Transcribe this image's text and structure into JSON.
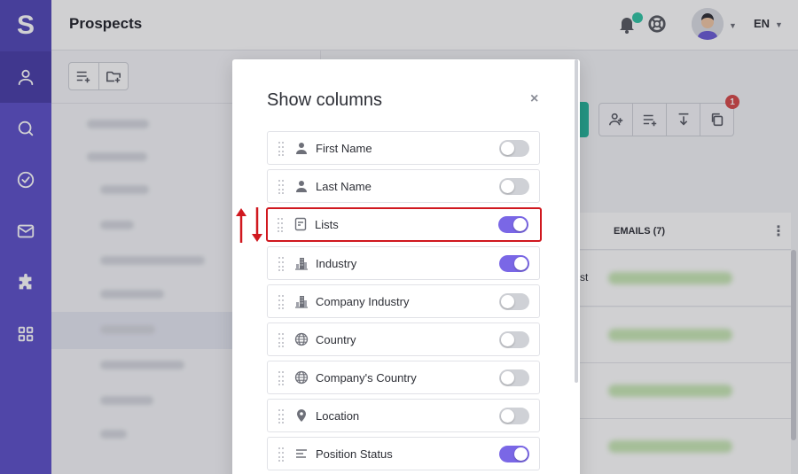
{
  "app": {
    "logo_letter": "S",
    "page_title": "Prospects"
  },
  "header": {
    "language": "EN",
    "notification_indicator": "online"
  },
  "sidebar": {
    "items": [
      {
        "icon": "person-icon",
        "active": true
      },
      {
        "icon": "search-icon",
        "active": false
      },
      {
        "icon": "check-circle-icon",
        "active": false
      },
      {
        "icon": "mail-icon",
        "active": false
      },
      {
        "icon": "puzzle-icon",
        "active": false
      },
      {
        "icon": "grid-icon",
        "active": false
      }
    ]
  },
  "toolbar": {
    "badge_count": "1"
  },
  "table": {
    "emails_column": "EMAILS (7)",
    "row_partial_text": "st"
  },
  "modal": {
    "title": "Show columns",
    "close_symbol": "×",
    "columns": [
      {
        "label": "First Name",
        "icon": "person-icon",
        "enabled": false
      },
      {
        "label": "Last Name",
        "icon": "person-icon",
        "enabled": false
      },
      {
        "label": "Lists",
        "icon": "list-icon",
        "enabled": true,
        "highlighted": true
      },
      {
        "label": "Industry",
        "icon": "building-icon",
        "enabled": true
      },
      {
        "label": "Company Industry",
        "icon": "building-icon",
        "enabled": false
      },
      {
        "label": "Country",
        "icon": "globe-icon",
        "enabled": false
      },
      {
        "label": "Company's Country",
        "icon": "globe-icon",
        "enabled": false
      },
      {
        "label": "Location",
        "icon": "location-pin-icon",
        "enabled": false
      },
      {
        "label": "Position Status",
        "icon": "text-lines-icon",
        "enabled": true
      }
    ]
  },
  "colors": {
    "sidebar": "#5b4fc9",
    "toggle_on": "#7a67e6",
    "toggle_off": "#cfd1d6",
    "highlight_border": "#d0181f",
    "accent_teal": "#23b59c",
    "badge": "#d64747"
  }
}
